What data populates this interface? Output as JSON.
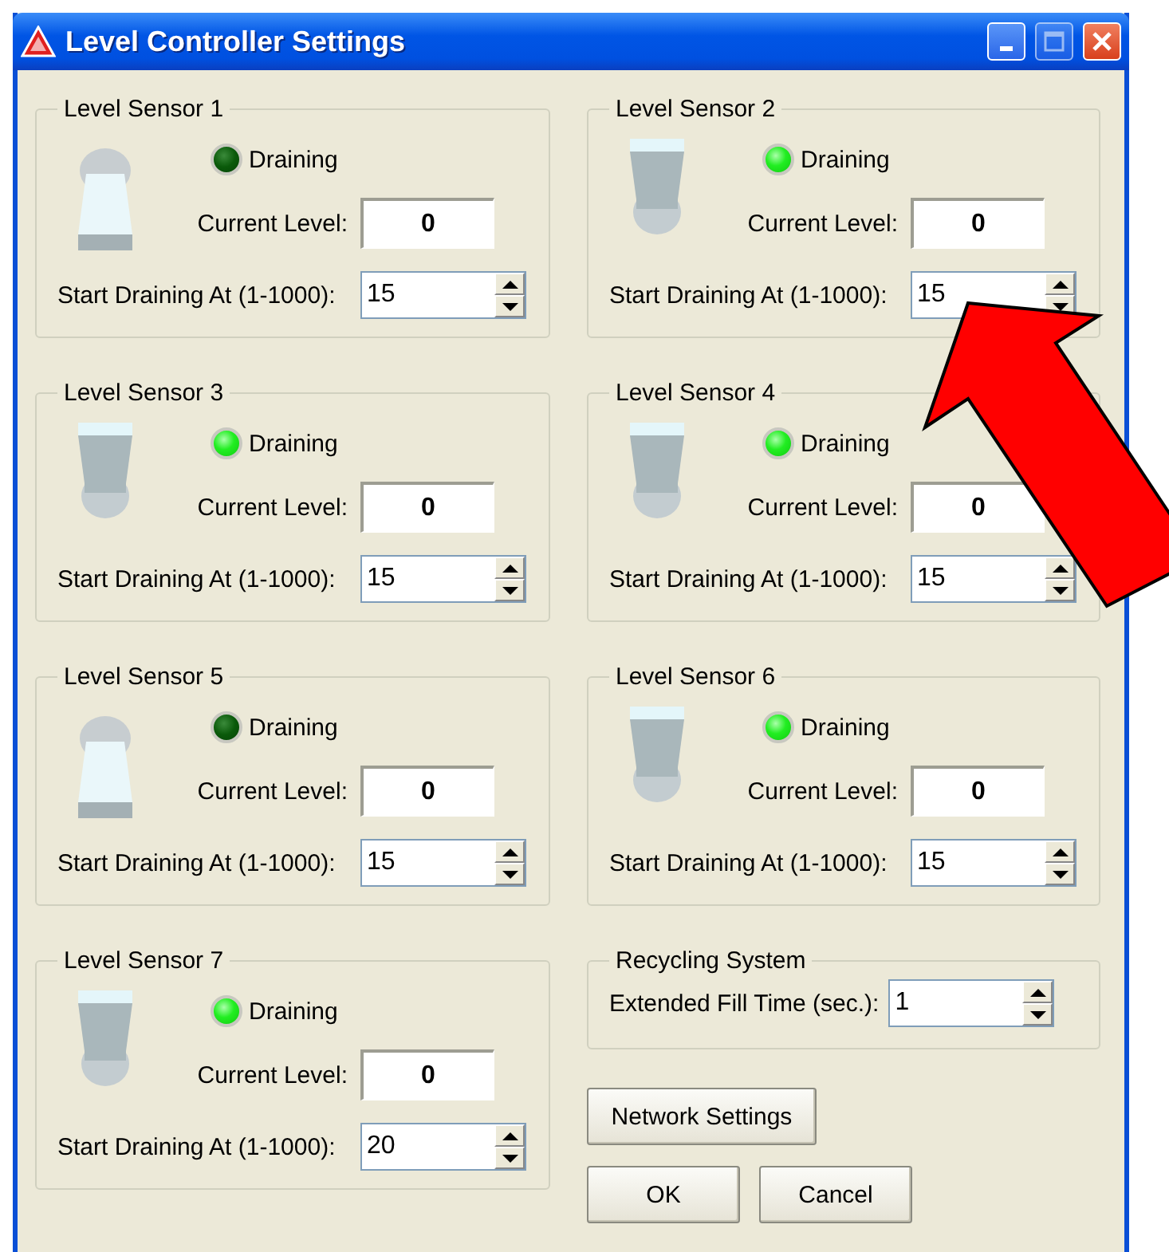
{
  "window": {
    "title": "Level Controller Settings"
  },
  "sensors": [
    {
      "title": "Level Sensor 1",
      "draining": false,
      "status_label": "Draining",
      "current_level_label": "Current Level:",
      "current_level": "0",
      "start_label": "Start Draining At (1-1000):",
      "start_value": "15"
    },
    {
      "title": "Level Sensor 2",
      "draining": true,
      "status_label": "Draining",
      "current_level_label": "Current Level:",
      "current_level": "0",
      "start_label": "Start Draining At (1-1000):",
      "start_value": "15"
    },
    {
      "title": "Level Sensor 3",
      "draining": true,
      "status_label": "Draining",
      "current_level_label": "Current Level:",
      "current_level": "0",
      "start_label": "Start Draining At (1-1000):",
      "start_value": "15"
    },
    {
      "title": "Level Sensor 4",
      "draining": true,
      "status_label": "Draining",
      "current_level_label": "Current Level:",
      "current_level": "0",
      "start_label": "Start Draining At (1-1000):",
      "start_value": "15"
    },
    {
      "title": "Level Sensor 5",
      "draining": false,
      "status_label": "Draining",
      "current_level_label": "Current Level:",
      "current_level": "0",
      "start_label": "Start Draining At (1-1000):",
      "start_value": "15"
    },
    {
      "title": "Level Sensor 6",
      "draining": true,
      "status_label": "Draining",
      "current_level_label": "Current Level:",
      "current_level": "0",
      "start_label": "Start Draining At (1-1000):",
      "start_value": "15"
    },
    {
      "title": "Level Sensor 7",
      "draining": true,
      "status_label": "Draining",
      "current_level_label": "Current Level:",
      "current_level": "0",
      "start_label": "Start Draining At (1-1000):",
      "start_value": "20"
    }
  ],
  "recycling": {
    "title": "Recycling System",
    "label": "Extended Fill Time (sec.):",
    "value": "1"
  },
  "buttons": {
    "network": "Network Settings",
    "ok": "OK",
    "cancel": "Cancel"
  }
}
